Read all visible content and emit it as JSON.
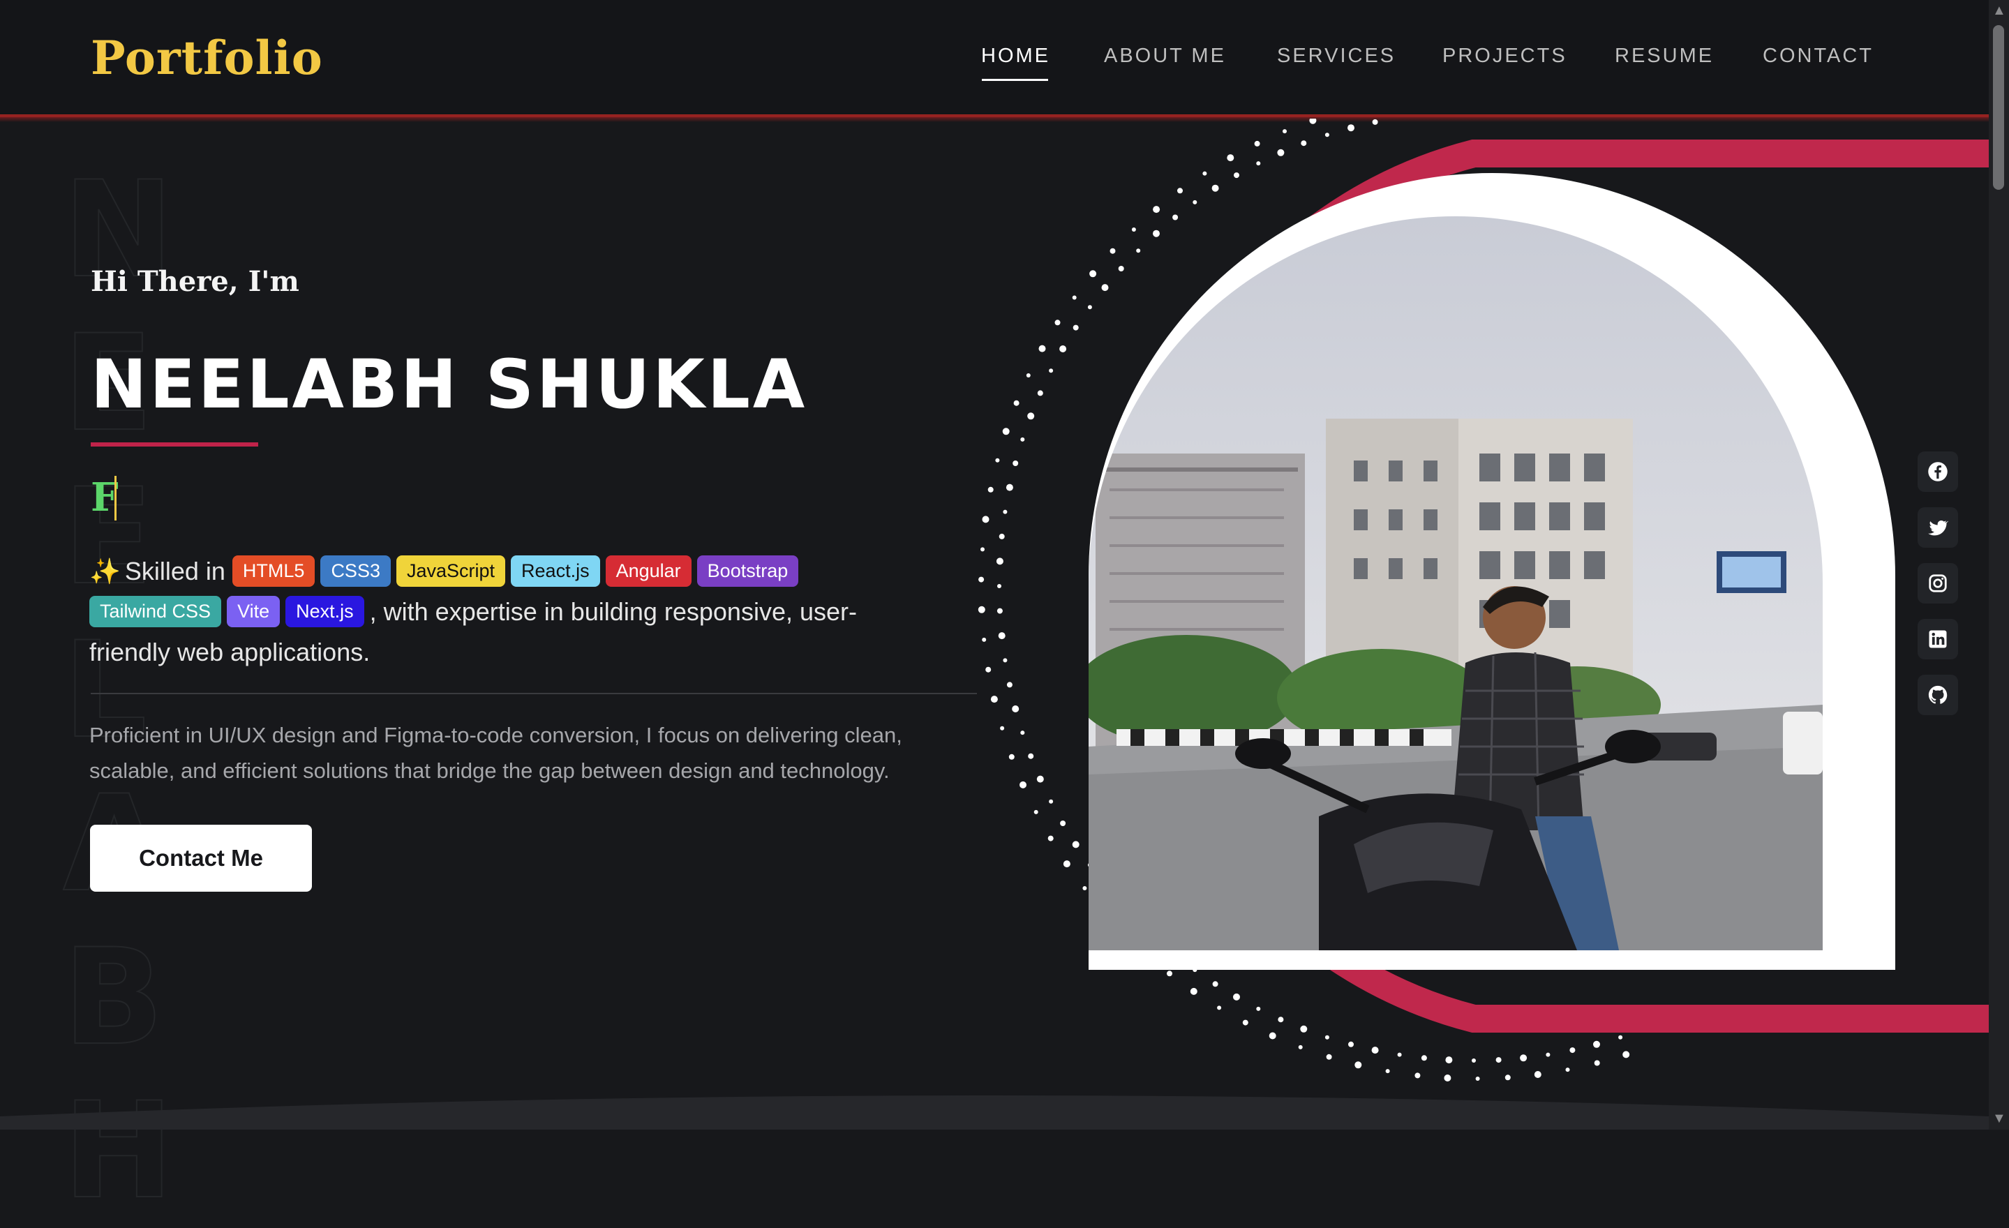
{
  "brand": {
    "logo": "Portfolio",
    "accent": "#f2c844",
    "primary_red": "#c0234a"
  },
  "nav": {
    "items": [
      {
        "label": "HOME",
        "active": true
      },
      {
        "label": "ABOUT ME",
        "active": false
      },
      {
        "label": "SERVICES",
        "active": false
      },
      {
        "label": "PROJECTS",
        "active": false
      },
      {
        "label": "RESUME",
        "active": false
      },
      {
        "label": "CONTACT",
        "active": false
      }
    ]
  },
  "hero": {
    "background_word": "NEELABH",
    "greeting": "Hi There, I'm",
    "name": "NEELABH SHUKLA",
    "typed_text": "F",
    "skills_intro": "Skilled in",
    "skills": [
      {
        "label": "HTML5",
        "bg": "#e44d26",
        "fg": "#ffffff"
      },
      {
        "label": "CSS3",
        "bg": "#3c7ac5",
        "fg": "#ffffff"
      },
      {
        "label": "JavaScript",
        "bg": "#f0d43a",
        "fg": "#111111"
      },
      {
        "label": "React.js",
        "bg": "#7fd6f4",
        "fg": "#111111"
      },
      {
        "label": "Angular",
        "bg": "#d62c34",
        "fg": "#ffffff"
      },
      {
        "label": "Bootstrap",
        "bg": "#7a3fc4",
        "fg": "#ffffff"
      },
      {
        "label": "Tailwind CSS",
        "bg": "#3aa8a2",
        "fg": "#ffffff"
      },
      {
        "label": "Vite",
        "bg": "#7b61f2",
        "fg": "#ffffff"
      },
      {
        "label": "Next.js",
        "bg": "#2a17e0",
        "fg": "#ffffff"
      }
    ],
    "skills_outro": ", with expertise in building responsive, user-friendly web applications.",
    "description": "Proficient in UI/UX design and Figma-to-code conversion, I focus on delivering clean, scalable, and efficient solutions that bridge the gap between design and technology.",
    "cta_label": "Contact Me"
  },
  "social": [
    {
      "icon": "facebook-icon"
    },
    {
      "icon": "twitter-icon"
    },
    {
      "icon": "instagram-icon"
    },
    {
      "icon": "linkedin-icon"
    },
    {
      "icon": "github-icon"
    }
  ]
}
